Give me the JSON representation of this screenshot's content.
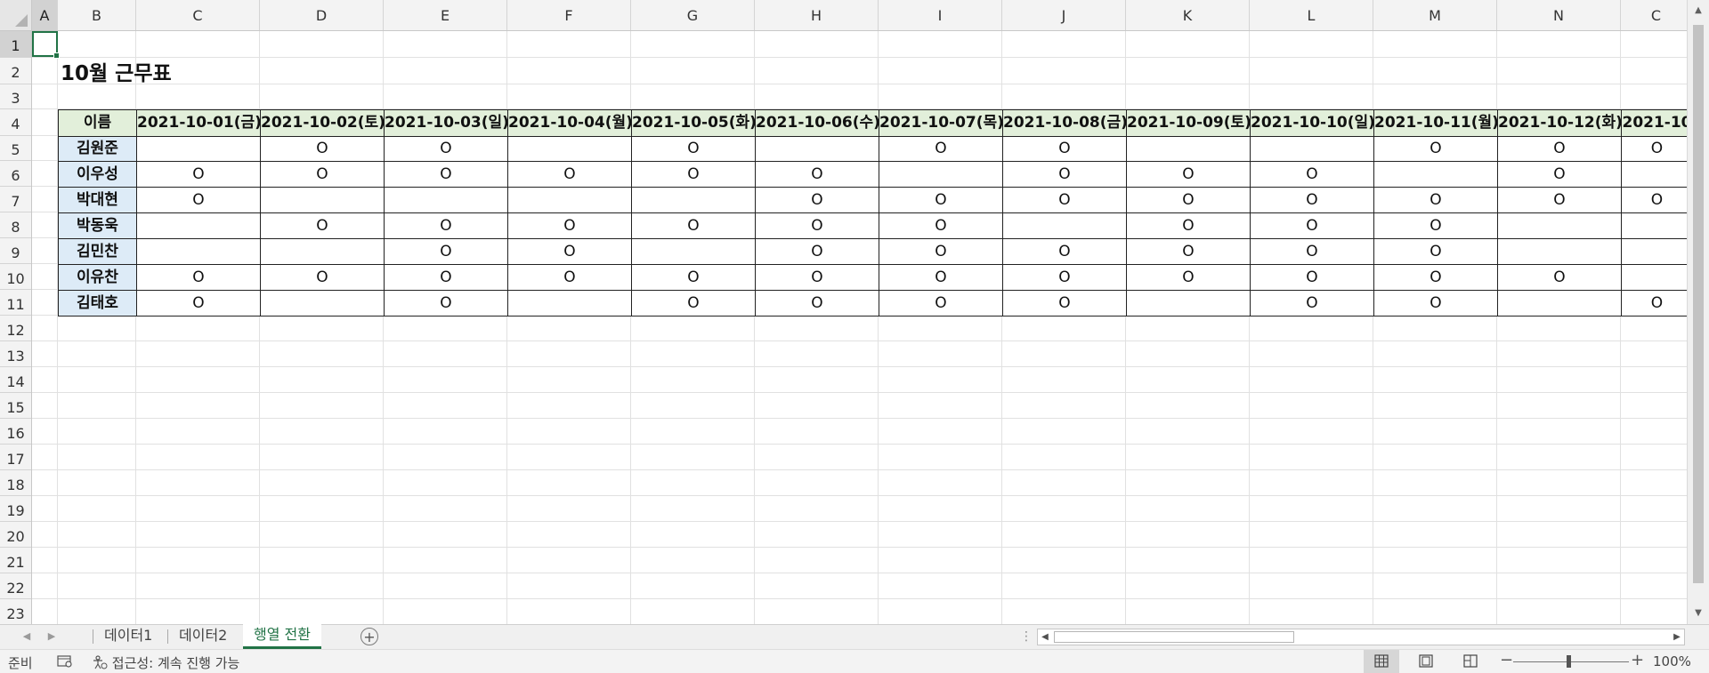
{
  "columns": [
    "A",
    "B",
    "C",
    "D",
    "E",
    "F",
    "G",
    "H",
    "I",
    "J",
    "K",
    "L",
    "M",
    "N",
    "C"
  ],
  "rows": [
    "1",
    "2",
    "3",
    "4",
    "5",
    "6",
    "7",
    "8",
    "9",
    "10",
    "11",
    "12",
    "13",
    "14",
    "15",
    "16",
    "17",
    "18",
    "19",
    "20",
    "21",
    "22",
    "23"
  ],
  "sheet_title": "10월 근무표",
  "table": {
    "name_header": "이름",
    "dates": [
      "2021-10-01(금)",
      "2021-10-02(토)",
      "2021-10-03(일)",
      "2021-10-04(월)",
      "2021-10-05(화)",
      "2021-10-06(수)",
      "2021-10-07(목)",
      "2021-10-08(금)",
      "2021-10-09(토)",
      "2021-10-10(일)",
      "2021-10-11(월)",
      "2021-10-12(화)",
      "2021-10"
    ],
    "rows": [
      {
        "name": "김원준",
        "marks": [
          "",
          "O",
          "O",
          "",
          "O",
          "",
          "O",
          "O",
          "",
          "",
          "O",
          "O",
          "O"
        ]
      },
      {
        "name": "이우성",
        "marks": [
          "O",
          "O",
          "O",
          "O",
          "O",
          "O",
          "",
          "O",
          "O",
          "O",
          "",
          "O",
          ""
        ]
      },
      {
        "name": "박대현",
        "marks": [
          "O",
          "",
          "",
          "",
          "",
          "O",
          "O",
          "O",
          "O",
          "O",
          "O",
          "O",
          "O"
        ]
      },
      {
        "name": "박동욱",
        "marks": [
          "",
          "O",
          "O",
          "O",
          "O",
          "O",
          "O",
          "",
          "O",
          "O",
          "O",
          "",
          ""
        ]
      },
      {
        "name": "김민찬",
        "marks": [
          "",
          "",
          "O",
          "O",
          "",
          "O",
          "O",
          "O",
          "O",
          "O",
          "O",
          "",
          ""
        ]
      },
      {
        "name": "이유찬",
        "marks": [
          "O",
          "O",
          "O",
          "O",
          "O",
          "O",
          "O",
          "O",
          "O",
          "O",
          "O",
          "O",
          ""
        ]
      },
      {
        "name": "김태호",
        "marks": [
          "O",
          "",
          "O",
          "",
          "O",
          "O",
          "O",
          "O",
          "",
          "O",
          "O",
          "",
          "O"
        ]
      }
    ]
  },
  "sheet_tabs": [
    "데이터1",
    "데이터2",
    "행열 전환"
  ],
  "active_sheet_index": 2,
  "status": {
    "ready": "준비",
    "accessibility": "접근성: 계속 진행 가능",
    "zoom": "100%",
    "zoom_percent": 100
  },
  "colors": {
    "header_fill": "#e2efda",
    "name_fill": "#ddebf7",
    "accent": "#217346"
  },
  "icons": [
    "select-all-icon",
    "macro-record-icon",
    "accessibility-icon",
    "normal-view-icon",
    "page-layout-icon",
    "page-break-icon"
  ]
}
